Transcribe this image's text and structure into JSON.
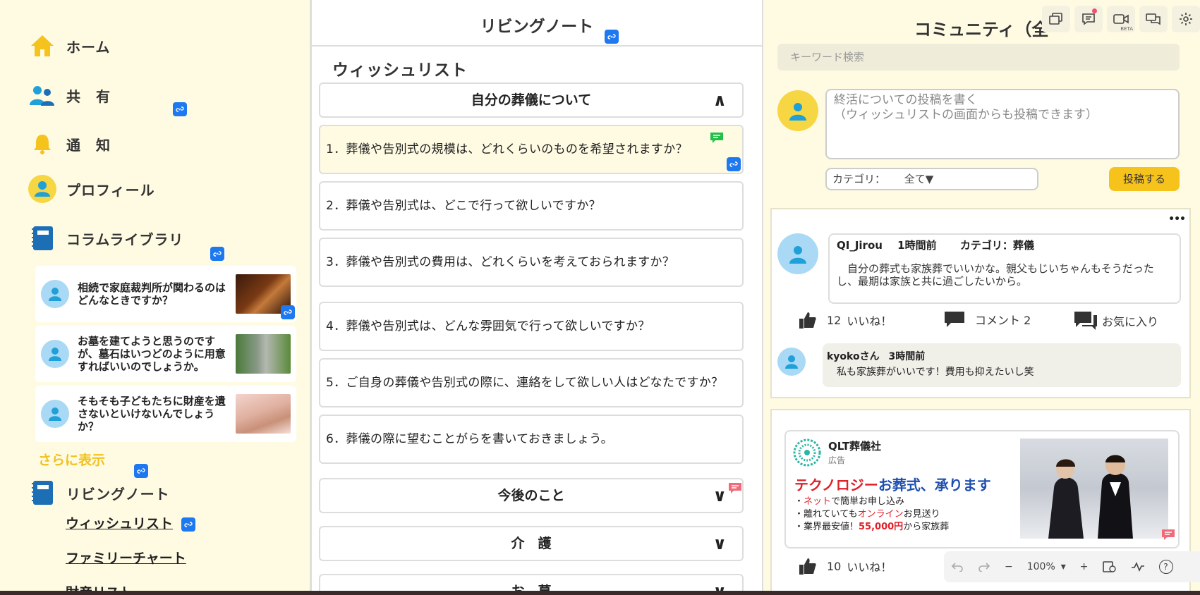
{
  "sidebar": {
    "nav": [
      {
        "label": "ホーム",
        "icon": "home-icon"
      },
      {
        "label": "共　有",
        "icon": "users-icon"
      },
      {
        "label": "通　知",
        "icon": "bell-icon"
      },
      {
        "label": "プロフィール",
        "icon": "profile-icon"
      },
      {
        "label": "コラムライブラリ",
        "icon": "book-icon"
      }
    ],
    "articles": [
      {
        "text": "相続で家庭裁判所が関わるのはどんなときですか？",
        "thumb": "gavel-photo"
      },
      {
        "text": "お墓を建てようと思うのですが、墓石はいつどのように用意すればいいのでしょうか。",
        "thumb": "gravestone-photo"
      },
      {
        "text": "そもそも子どもたちに財産を遺さないといけないんでしょうか？",
        "thumb": "money-photo"
      }
    ],
    "more_label": "さらに表示",
    "living_note": {
      "label": "リビングノート",
      "links": [
        "ウィッシュリスト",
        "ファミリーチャート",
        "財産リスト"
      ]
    }
  },
  "middle": {
    "header_title": "リビングノート",
    "section_title": "ウィッシュリスト",
    "open_section": "自分の葬儀について",
    "questions": [
      "1．葬儀や告別式の規模は、どれくらいのものを希望されますか？",
      "2．葬儀や告別式は、どこで行って欲しいですか？",
      "3．葬儀や告別式の費用は、どれくらいを考えておられますか？",
      "4．葬儀や告別式は、どんな雰囲気で行って欲しいですか？",
      "5．ご自身の葬儀や告別式の際に、連絡をして欲しい人はどなたですか？",
      "6．葬儀の際に望むことがらを書いておきましょう。"
    ],
    "collapsed_sections": [
      "今後のこと",
      "介　護",
      "お　墓"
    ],
    "chevron_up": "∧",
    "chevron_down": "∨"
  },
  "right": {
    "title": "コミュニティ（全",
    "search_placeholder": "キーワード検索",
    "compose_placeholder": "終活についての投稿を書く\n（ウィッシュリストの画面からも投稿できます）",
    "category_label": "カテゴリ：",
    "category_value": "全て▼",
    "post_button": "投稿する",
    "post": {
      "author": "QI_Jirou",
      "time": "1時間前",
      "category": "カテゴリ：葬儀",
      "text": "自分の葬式も家族葬でいいかな。親父もじいちゃんもそうだったし、最期は家族と共に過ごしたいから。",
      "likes_count": "12",
      "likes_label": "いいね！",
      "comment_label": "コメント 2",
      "favorite_label": "お気に入り",
      "more": "•••",
      "comment": {
        "author": "kyokoさん",
        "time": "3時間前",
        "text": "私も家族葬がいいです！費用も抑えたいし笑"
      }
    },
    "ad": {
      "company": "QLT葬儀社",
      "tag": "広告",
      "headline_a": "テクノロジー",
      "headline_b": "お葬式、承ります",
      "line1_pre": "・",
      "line1_red": "ネット",
      "line1_post": "で簡単お申し込み",
      "line2_pre": "・離れていても",
      "line2_red": "オンライン",
      "line2_post": "お見送り",
      "line3_pre": "・業界最安値！",
      "line3_red": "55,000円",
      "line3_post": "から家族葬",
      "likes_count": "10",
      "likes_label": "いいね！"
    },
    "toolbar": {
      "beta": "BETA"
    }
  },
  "zoom": {
    "value": "100%",
    "minus": "−",
    "plus": "+",
    "chev": "▾",
    "help": "?"
  },
  "colors": {
    "accent_yellow": "#f6c21c",
    "sidebar_bg": "#fffbe3",
    "link_blue": "#1e78f0",
    "ad_red": "#e0202a",
    "ad_blue": "#1e4fb0"
  }
}
